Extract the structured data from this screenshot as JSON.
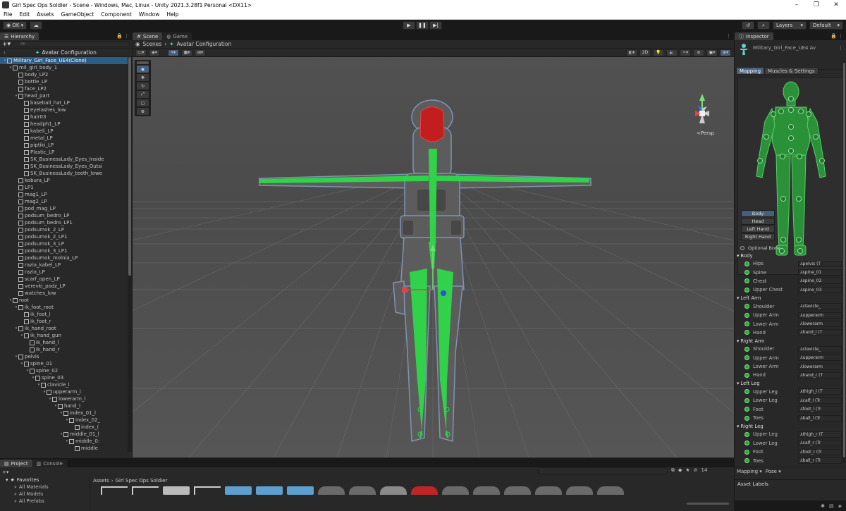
{
  "window": {
    "title": "Girl Spec Ops Soldier - Scene - Windows, Mac, Linux - Unity 2021.3.28f1 Personal <DX11>",
    "controls": [
      "–",
      "❐",
      "✕"
    ]
  },
  "menu": [
    "File",
    "Edit",
    "Assets",
    "GameObject",
    "Component",
    "Window",
    "Help"
  ],
  "toolbar": {
    "account_label": "OK ▾",
    "layers_label": "Layers",
    "layout_label": "Default"
  },
  "hierarchy": {
    "tab_label": "Hierarchy",
    "search_placeholder": "All",
    "scene_label": "Avatar Configuration",
    "items": [
      {
        "label": "Military_Girl_Face_UE4(Clone)",
        "depth": 0,
        "arrow": "▾",
        "selected": true
      },
      {
        "label": "mil_girl_body_1",
        "depth": 1,
        "arrow": "▾"
      },
      {
        "label": "body_LP2",
        "depth": 2,
        "arrow": ""
      },
      {
        "label": "bottle_LP",
        "depth": 2,
        "arrow": ""
      },
      {
        "label": "face_LP2",
        "depth": 2,
        "arrow": ""
      },
      {
        "label": "head_part",
        "depth": 2,
        "arrow": "▾"
      },
      {
        "label": "baseball_hat_LP",
        "depth": 3,
        "arrow": ""
      },
      {
        "label": "eyelashes_low",
        "depth": 3,
        "arrow": ""
      },
      {
        "label": "hair03",
        "depth": 3,
        "arrow": ""
      },
      {
        "label": "headph1_LP",
        "depth": 3,
        "arrow": ""
      },
      {
        "label": "kabeli_LP",
        "depth": 3,
        "arrow": ""
      },
      {
        "label": "metal_LP",
        "depth": 3,
        "arrow": ""
      },
      {
        "label": "piptiki_LP",
        "depth": 3,
        "arrow": ""
      },
      {
        "label": "Plastic_LP",
        "depth": 3,
        "arrow": ""
      },
      {
        "label": "SK_BusinessLady_Eyes_Inside",
        "depth": 3,
        "arrow": ""
      },
      {
        "label": "SK_BusinessLady_Eyes_Outsi",
        "depth": 3,
        "arrow": ""
      },
      {
        "label": "SK_BusinessLady_teeth_lowe",
        "depth": 3,
        "arrow": ""
      },
      {
        "label": "kobura_LP",
        "depth": 2,
        "arrow": ""
      },
      {
        "label": "LP1",
        "depth": 2,
        "arrow": ""
      },
      {
        "label": "mag1_LP",
        "depth": 2,
        "arrow": ""
      },
      {
        "label": "mag2_LP",
        "depth": 2,
        "arrow": ""
      },
      {
        "label": "pod_mag_LP",
        "depth": 2,
        "arrow": ""
      },
      {
        "label": "podsum_bedro_LP",
        "depth": 2,
        "arrow": ""
      },
      {
        "label": "podsum_bedro_LP1",
        "depth": 2,
        "arrow": ""
      },
      {
        "label": "podsumok_2_LP",
        "depth": 2,
        "arrow": ""
      },
      {
        "label": "podsumok_2_LP1",
        "depth": 2,
        "arrow": ""
      },
      {
        "label": "podsumok_3_LP",
        "depth": 2,
        "arrow": ""
      },
      {
        "label": "podsumok_3_LP1",
        "depth": 2,
        "arrow": ""
      },
      {
        "label": "podsumok_molnia_LP",
        "depth": 2,
        "arrow": ""
      },
      {
        "label": "razia_kabel_LP",
        "depth": 2,
        "arrow": ""
      },
      {
        "label": "razia_LP",
        "depth": 2,
        "arrow": ""
      },
      {
        "label": "scarf_open_LP",
        "depth": 2,
        "arrow": ""
      },
      {
        "label": "verevki_podz_LP",
        "depth": 2,
        "arrow": ""
      },
      {
        "label": "watches_low",
        "depth": 2,
        "arrow": ""
      },
      {
        "label": "root",
        "depth": 1,
        "arrow": "▾"
      },
      {
        "label": "ik_foot_root",
        "depth": 2,
        "arrow": "▾"
      },
      {
        "label": "ik_foot_l",
        "depth": 3,
        "arrow": ""
      },
      {
        "label": "ik_foot_r",
        "depth": 3,
        "arrow": ""
      },
      {
        "label": "ik_hand_root",
        "depth": 2,
        "arrow": "▾"
      },
      {
        "label": "ik_hand_gun",
        "depth": 3,
        "arrow": "▾"
      },
      {
        "label": "ik_hand_l",
        "depth": 4,
        "arrow": ""
      },
      {
        "label": "ik_hand_r",
        "depth": 4,
        "arrow": ""
      },
      {
        "label": "pelvis",
        "depth": 2,
        "arrow": "▾"
      },
      {
        "label": "spine_01",
        "depth": 3,
        "arrow": "▾"
      },
      {
        "label": "spine_02",
        "depth": 4,
        "arrow": "▾"
      },
      {
        "label": "spine_03",
        "depth": 5,
        "arrow": "▾"
      },
      {
        "label": "clavicle_l",
        "depth": 6,
        "arrow": "▾"
      },
      {
        "label": "upperarm_l",
        "depth": 7,
        "arrow": "▾"
      },
      {
        "label": "lowerarm_l",
        "depth": 8,
        "arrow": "▾"
      },
      {
        "label": "hand_l",
        "depth": 9,
        "arrow": "▾"
      },
      {
        "label": "index_01_l",
        "depth": 10,
        "arrow": "▾"
      },
      {
        "label": "index_02_",
        "depth": 11,
        "arrow": "▾"
      },
      {
        "label": "index_(",
        "depth": 12,
        "arrow": ""
      },
      {
        "label": "middle_01_l",
        "depth": 10,
        "arrow": "▾"
      },
      {
        "label": "middle_0:",
        "depth": 11,
        "arrow": "▾"
      },
      {
        "label": "middle",
        "depth": 12,
        "arrow": ""
      }
    ]
  },
  "scene": {
    "tabs": [
      "Scene",
      "Game"
    ],
    "breadcrumb_root": "Scenes",
    "breadcrumb_current": "Avatar Configuration",
    "toggle_2d": "2D",
    "persp_label": "<Persp"
  },
  "inspector": {
    "tab_label": "Inspector",
    "object_name": "Military_Girl_Face_UE4 Av",
    "tabs": [
      "Mapping",
      "Muscles & Settings"
    ],
    "body_parts": [
      "Body",
      "Head",
      "Left Hand",
      "Right Hand"
    ],
    "optional_bone_label": "Optional Bone",
    "groups": [
      {
        "name": "Body",
        "bones": [
          {
            "name": "Hips",
            "value": "⅄pelvis (T"
          },
          {
            "name": "Spine",
            "value": "⅄spine_01"
          },
          {
            "name": "Chest",
            "value": "⅄spine_02"
          },
          {
            "name": "Upper Chest",
            "value": "⅄spine_03"
          }
        ]
      },
      {
        "name": "Left Arm",
        "bones": [
          {
            "name": "Shoulder",
            "value": "⅄clavicle_"
          },
          {
            "name": "Upper Arm",
            "value": "⅄upperarm"
          },
          {
            "name": "Lower Arm",
            "value": "⅄lowerarm"
          },
          {
            "name": "Hand",
            "value": "⅄hand_l (T"
          }
        ]
      },
      {
        "name": "Right Arm",
        "bones": [
          {
            "name": "Shoulder",
            "value": "⅄clavicle_"
          },
          {
            "name": "Upper Arm",
            "value": "⅄upperarm"
          },
          {
            "name": "Lower Arm",
            "value": "⅄lowerarm"
          },
          {
            "name": "Hand",
            "value": "⅄hand_r (T"
          }
        ]
      },
      {
        "name": "Left Leg",
        "bones": [
          {
            "name": "Upper Leg",
            "value": "⅄thigh_l (T"
          },
          {
            "name": "Lower Leg",
            "value": "⅄calf_l (Tr"
          },
          {
            "name": "Foot",
            "value": "⅄foot_l (Tr"
          },
          {
            "name": "Toes",
            "value": "⅄ball_l (Tr"
          }
        ]
      },
      {
        "name": "Right Leg",
        "bones": [
          {
            "name": "Upper Leg",
            "value": "⅄thigh_r (T"
          },
          {
            "name": "Lower Leg",
            "value": "⅄calf_r (Tr"
          },
          {
            "name": "Foot",
            "value": "⅄foot_r (Tr"
          },
          {
            "name": "Toes",
            "value": "⅄ball_r (Tr"
          }
        ]
      }
    ],
    "mapping_menu": "Mapping ▾",
    "pose_menu": "Pose ▾",
    "asset_labels": "Asset Labels"
  },
  "project": {
    "tabs": [
      "Project",
      "Console"
    ],
    "favorites_label": "Favorites",
    "favorites": [
      "All Materials",
      "All Models",
      "All Prefabs"
    ],
    "path_root": "Assets",
    "path_current": "Girl Spec Ops Soldier",
    "hidden_count": "14"
  },
  "colors": {
    "bone_green": "#2fd84a",
    "selection_blue": "#2c5d87",
    "head_red": "#cc1f1f"
  }
}
